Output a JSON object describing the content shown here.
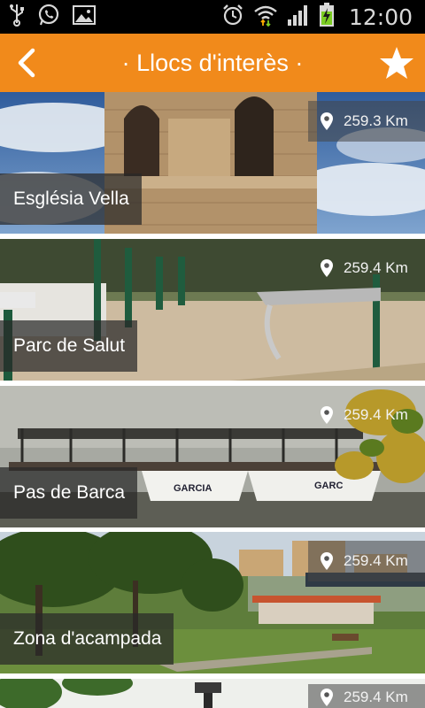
{
  "status_bar": {
    "time": "12:00",
    "icons": [
      "usb-icon",
      "whatsapp-icon",
      "gallery-icon",
      "alarm-icon",
      "wifi-icon",
      "signal-icon",
      "battery-charging-icon"
    ]
  },
  "action_bar": {
    "title": "· Llocs d'interès ·",
    "back_icon": "chevron-left-icon",
    "favorite_icon": "star-icon",
    "color": "#f18a1b"
  },
  "places": [
    {
      "name": "Església Vella",
      "distance": "259.3 Km"
    },
    {
      "name": "Parc de Salut",
      "distance": "259.4 Km"
    },
    {
      "name": "Pas de Barca",
      "distance": "259.4 Km"
    },
    {
      "name": "Zona d'acampada",
      "distance": "259.4 Km"
    },
    {
      "name": "",
      "distance": "259.4 Km"
    }
  ]
}
